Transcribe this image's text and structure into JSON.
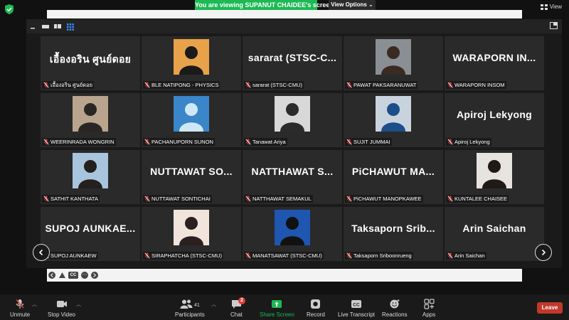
{
  "banner": {
    "text": "You are viewing SUPANUT CHAIDEE's screen"
  },
  "view_options": {
    "label": "View Options ⌄"
  },
  "view_button": {
    "label": "View"
  },
  "participants_grid": [
    {
      "big": "เอื้องอริน ศูนย์ดอย",
      "label": "เอื้องอริน ศูนย์ดอย",
      "photo": false
    },
    {
      "big": "",
      "label": "BLE NATIPONG - PHYSICS",
      "photo": true,
      "photo_bg": "#e8a24a",
      "photo_fg": "#1a1a1a"
    },
    {
      "big": "sararat  (STSC-C...",
      "label": "sararat (STSC-CMU)",
      "photo": false
    },
    {
      "big": "",
      "label": "PAWAT PAKSARANUWAT",
      "photo": true,
      "photo_bg": "#8a8f94",
      "photo_fg": "#3a2a22"
    },
    {
      "big": "WARAPORN  IN...",
      "label": "WARAPORN INSOM",
      "photo": false
    },
    {
      "big": "",
      "label": "WEERINRADA WONGRIN",
      "photo": true,
      "photo_bg": "#b9a58e",
      "photo_fg": "#2a2624"
    },
    {
      "big": "",
      "label": "PACHANUPORN SUNON",
      "photo": true,
      "photo_bg": "#3a86c8",
      "photo_fg": "#cfe8f7"
    },
    {
      "big": "",
      "label": "Tanawat Ariya",
      "photo": true,
      "photo_bg": "#d8d8d8",
      "photo_fg": "#2b2b2b"
    },
    {
      "big": "",
      "label": "SUJIT JUMMAI",
      "photo": true,
      "photo_bg": "#c9d3de",
      "photo_fg": "#1b4f8a"
    },
    {
      "big": "Apiroj Lekyong",
      "label": "Apiroj Lekyong",
      "photo": false
    },
    {
      "big": "",
      "label": "SATHIT KANTHATA",
      "photo": true,
      "photo_bg": "#a9c4dd",
      "photo_fg": "#23201d"
    },
    {
      "big": "NUTTAWAT  SO...",
      "label": "NUTTAWAT SONTICHAI",
      "photo": false
    },
    {
      "big": "NATTHAWAT  S...",
      "label": "NATTHAWAT SEMAKUL",
      "photo": false
    },
    {
      "big": "PiCHAWUT  MA...",
      "label": "PiCHAWUT MANOPKAWEE",
      "photo": false
    },
    {
      "big": "",
      "label": "KUNTALEE CHAISEE",
      "photo": true,
      "photo_bg": "#e7e3df",
      "photo_fg": "#1f1a17"
    },
    {
      "big": "SUPOJ  AUNKAE...",
      "label": "SUPOJ AUNKAEW",
      "photo": false
    },
    {
      "big": "",
      "label": "SIRAPHATCHA (STSC-CMU)",
      "photo": true,
      "photo_bg": "#f0e4dc",
      "photo_fg": "#2a2020"
    },
    {
      "big": "",
      "label": "MANATSAWAT (STSC-CMU)",
      "photo": true,
      "photo_bg": "#1f56b0",
      "photo_fg": "#111111"
    },
    {
      "big": "Taksaporn  Srib...",
      "label": "Taksaporn Sriboonrueng",
      "photo": false
    },
    {
      "big": "Arin Saichan",
      "label": "Arin Saichan",
      "photo": false
    }
  ],
  "toolbar": {
    "unmute": "Unmute",
    "stop_video": "Stop Video",
    "participants": "Participants",
    "participants_count": "41",
    "chat": "Chat",
    "chat_badge": "2",
    "share_screen": "Share Screen",
    "record": "Record",
    "live_transcript": "Live Transcript",
    "reactions": "Reactions",
    "apps": "Apps",
    "leave": "Leave"
  },
  "screen_controls": {
    "cc": "CC",
    "more": "⋯"
  },
  "colors": {
    "share_green": "#1db954",
    "leave_red": "#c0392b",
    "mic_red": "#e03c3c"
  }
}
